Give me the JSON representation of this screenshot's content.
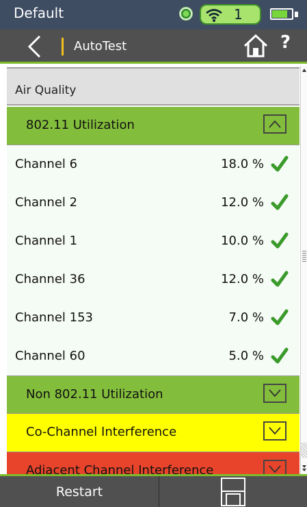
{
  "status_bar": {
    "profile": "Default",
    "wifi_count": "1",
    "battery_level": 0.8
  },
  "nav": {
    "title": "AutoTest",
    "help_label": "?"
  },
  "section": {
    "title": "Air Quality"
  },
  "groups": [
    {
      "label": "802.11 Utilization",
      "state": "expanded",
      "status_color": "#83bd3c"
    },
    {
      "label": "Non 802.11 Utilization",
      "state": "collapsed",
      "status_color": "#83bd3c"
    },
    {
      "label": "Co-Channel Interference",
      "state": "collapsed",
      "status_color": "#ffff00"
    },
    {
      "label": "Adjacent Channel Interference",
      "state": "collapsed",
      "status_color": "#e8442b"
    }
  ],
  "channels": [
    {
      "label": "Channel 6",
      "value": "18.0 %",
      "status": "check-icon"
    },
    {
      "label": "Channel 2",
      "value": "12.0 %",
      "status": "check-icon"
    },
    {
      "label": "Channel 1",
      "value": "10.0 %",
      "status": "check-icon"
    },
    {
      "label": "Channel 36",
      "value": "12.0 %",
      "status": "check-icon"
    },
    {
      "label": "Channel 153",
      "value": "7.0 %",
      "status": "check-icon"
    },
    {
      "label": "Channel 60",
      "value": "5.0 %",
      "status": "check-icon"
    }
  ],
  "bottom": {
    "restart_label": "Restart"
  },
  "colors": {
    "accent": "#7dbb2a",
    "pass": "#3a9a2a",
    "header_bg": "#3f4d63",
    "nav_bg": "#505050"
  }
}
